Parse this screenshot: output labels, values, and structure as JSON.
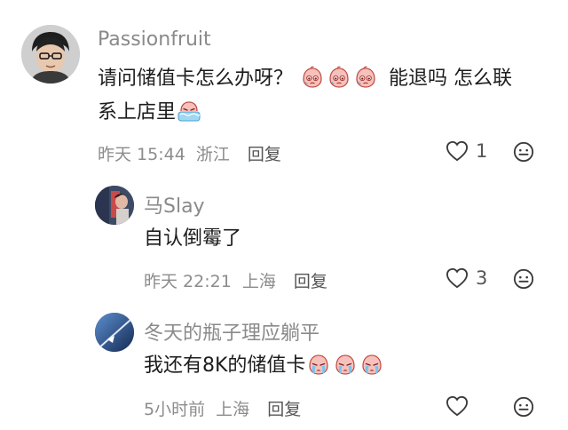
{
  "comments": [
    {
      "user": "Passionfruit",
      "text_line1": "请问储值卡怎么办呀？",
      "text_after_emoji": "能退吗 怎么联",
      "text_line2": "系上店里",
      "time": "昨天 15:44",
      "location": "浙江",
      "reply_label": "回复",
      "likes": "1"
    },
    {
      "user": "马Slay",
      "text": "自认倒霉了",
      "time": "昨天 22:21",
      "location": "上海",
      "reply_label": "回复",
      "likes": "3"
    },
    {
      "user": "冬天的瓶子理应躺平",
      "text": "我还有8K的储值卡",
      "time": "5小时前",
      "location": "上海",
      "reply_label": "回复",
      "likes": ""
    }
  ],
  "icons": {
    "like": "heart-outline-icon",
    "more": "dots-face-icon",
    "emoji_sob": "pleading-face-emoji",
    "emoji_cry": "crying-face-emoji"
  },
  "colors": {
    "text": "#1c1c1c",
    "meta": "#8c8c8c",
    "name": "#8a8a8a",
    "emoji_fill": "#f7b6b0"
  }
}
